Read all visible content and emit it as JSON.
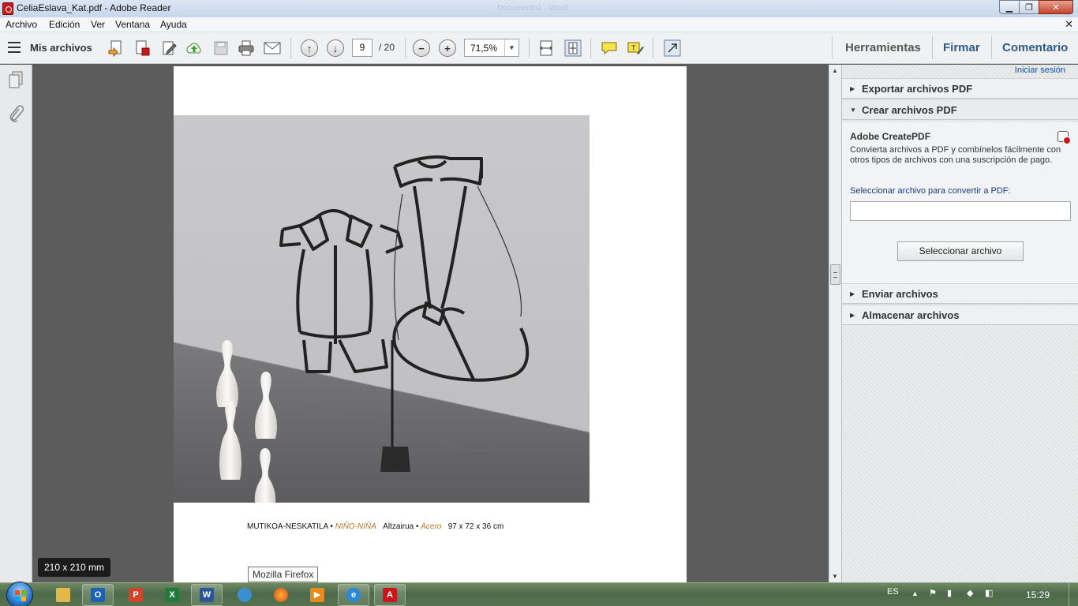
{
  "window": {
    "title": "CeliaEslava_Kat.pdf - Adobe Reader",
    "background_title": "Documento1 - Word"
  },
  "menu": [
    "Archivo",
    "Edición",
    "Ver",
    "Ventana",
    "Ayuda"
  ],
  "toolbar": {
    "my_files": "Mis archivos",
    "page_current": "9",
    "page_total": "/ 20",
    "zoom": "71,5%",
    "tools": "Herramientas",
    "sign": "Firmar",
    "comment": "Comentario"
  },
  "document": {
    "caption_title": "MUTIKOA-NESKATILA",
    "caption_sep1": " • ",
    "caption_title_es": "NIÑO-NIÑA",
    "caption_material_label": "Altzairua",
    "caption_sep2": " • ",
    "caption_material_es": "Acero",
    "caption_size": "97 x 72 x 36 cm",
    "page_size_badge": "210 x 210 mm",
    "tooltip": "Mozilla Firefox"
  },
  "right_pane": {
    "sign_in": "Iniciar sesión",
    "sections": {
      "export": "Exportar archivos PDF",
      "create": "Crear archivos PDF",
      "send": "Enviar archivos",
      "store": "Almacenar archivos"
    },
    "create_body": {
      "heading": "Adobe CreatePDF",
      "description": "Convierta archivos a PDF y combínelos fácilmente con otros tipos de archivos con una suscripción de pago.",
      "select_label": "Seleccionar archivo para convertir a PDF:",
      "select_button": "Seleccionar archivo"
    }
  },
  "taskbar": {
    "language": "ES",
    "clock": "15:29"
  },
  "colors": {
    "accent_blue": "#2e5a8a",
    "caption_orange": "#b5782a",
    "link_blue": "#1450a0"
  }
}
